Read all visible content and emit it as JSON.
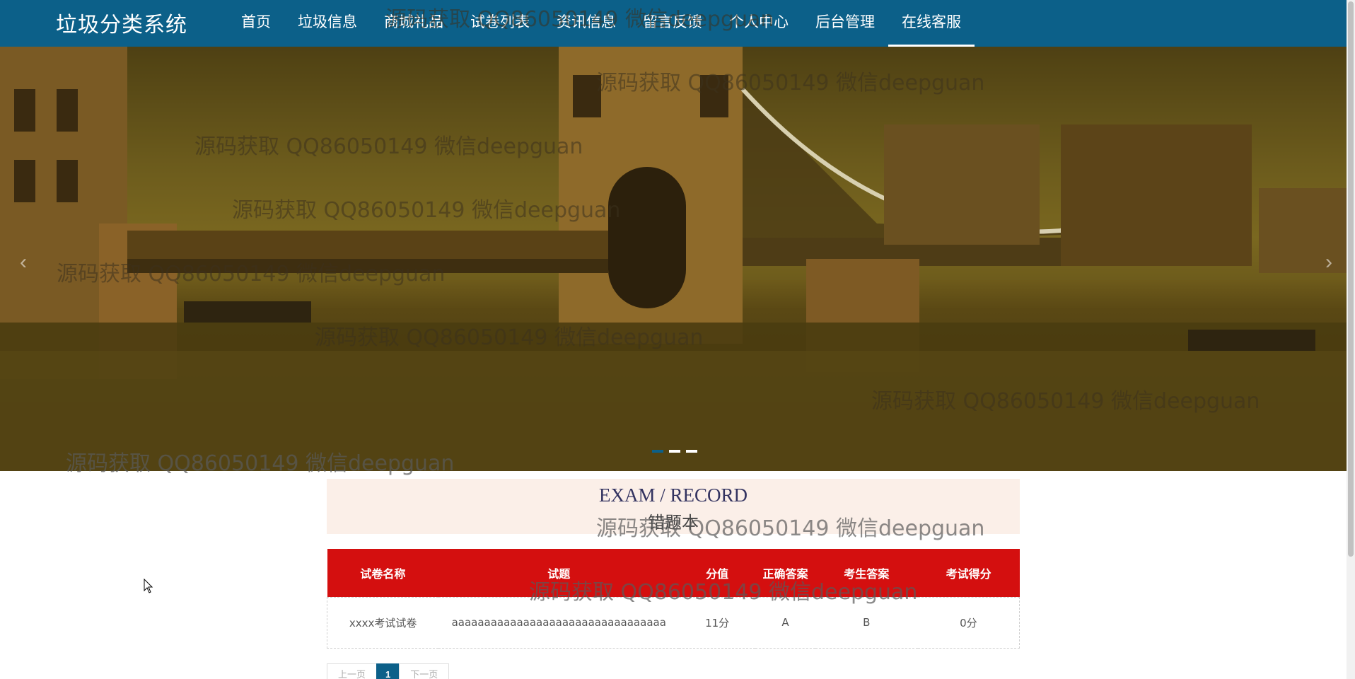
{
  "app": {
    "title": "垃圾分类系统"
  },
  "nav": {
    "items": [
      {
        "label": "首页"
      },
      {
        "label": "垃圾信息"
      },
      {
        "label": "商城礼品"
      },
      {
        "label": "试卷列表"
      },
      {
        "label": "资讯信息"
      },
      {
        "label": "留言反馈"
      },
      {
        "label": "个人中心"
      },
      {
        "label": "后台管理"
      },
      {
        "label": "在线客服",
        "active": true
      }
    ]
  },
  "banner": {
    "prev_icon": "chevron-left-icon",
    "next_icon": "chevron-right-icon",
    "prev_glyph": "‹",
    "next_glyph": "›",
    "slide_count": 3,
    "active_slide": 1
  },
  "section": {
    "title_en": "EXAM / RECORD",
    "title_cn": "错题本"
  },
  "table": {
    "headers": [
      "试卷名称",
      "试题",
      "分值",
      "正确答案",
      "考生答案",
      "考试得分"
    ],
    "rows": [
      [
        "xxxx考试试卷",
        "aaaaaaaaaaaaaaaaaaaaaaaaaaaaaaaaa",
        "11分",
        "A",
        "B",
        "0分"
      ]
    ]
  },
  "pagination": {
    "prev": "上一页",
    "current": "1",
    "next": "下一页"
  },
  "watermark": {
    "text": "源码获取 QQ86050149 微信deepguan"
  },
  "colors": {
    "nav_bg": "#0c6089",
    "table_header_bg": "#d40f0f",
    "section_bg": "#fbefe8"
  }
}
